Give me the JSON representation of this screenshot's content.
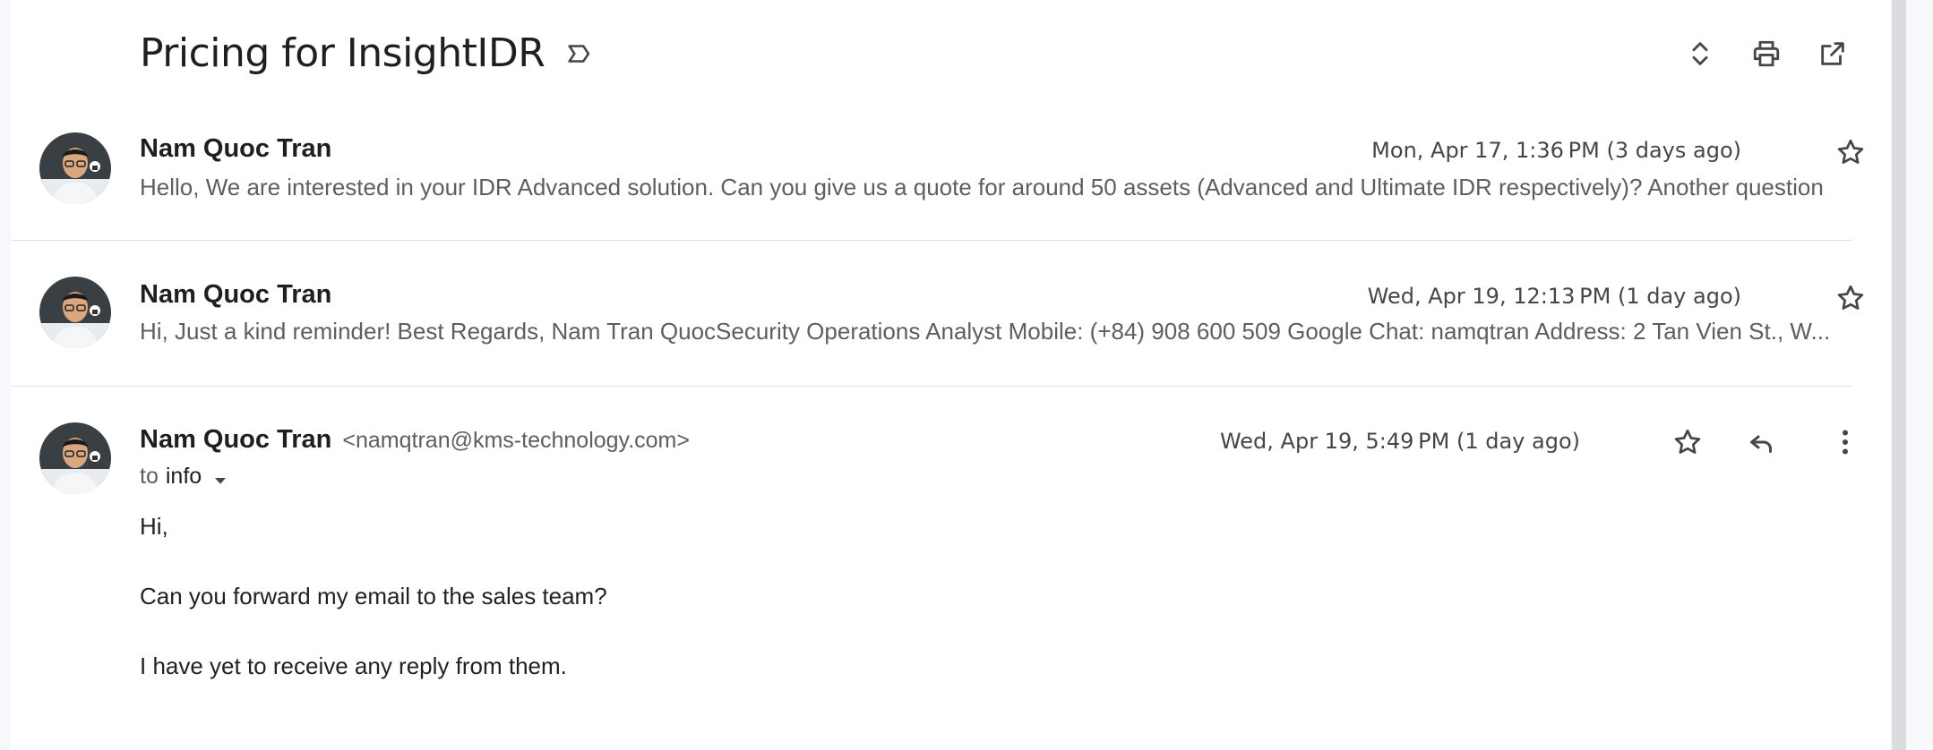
{
  "thread": {
    "subject": "Pricing for InsightIDR",
    "icons": {
      "label": "label-important-icon",
      "expand": "unfold-more-icon",
      "print": "print-icon",
      "open_new": "open-in-new-window-icon"
    }
  },
  "messages": [
    {
      "sender": "Nam Quoc Tran",
      "date": "Mon, Apr 17, 1:36 PM (3 days ago)",
      "snippet": "Hello, We are interested in your IDR Advanced solution. Can you give us a quote for around 50 assets (Advanced and Ultimate IDR respectively)? Another question",
      "starred": false
    },
    {
      "sender": "Nam Quoc Tran",
      "date": "Wed, Apr 19, 12:13 PM (1 day ago)",
      "snippet": "Hi, Just a kind reminder! Best Regards, Nam Tran QuocSecurity Operations Analyst Mobile: (+84) 908 600 509 Google Chat: namqtran Address: 2 Tan Vien St., W...",
      "starred": false
    },
    {
      "sender": "Nam Quoc Tran",
      "email": "<namqtran@kms-technology.com>",
      "date": "Wed, Apr 19, 5:49 PM (1 day ago)",
      "to_prefix": "to",
      "recipient": "info",
      "body": [
        "Hi,",
        "Can you forward my email to the sales team?",
        "I have yet to receive any reply from them."
      ],
      "starred": false
    }
  ],
  "colors": {
    "text_primary": "#1f1f1f",
    "text_secondary": "#5e5e5e",
    "divider": "#e3e3e3"
  }
}
